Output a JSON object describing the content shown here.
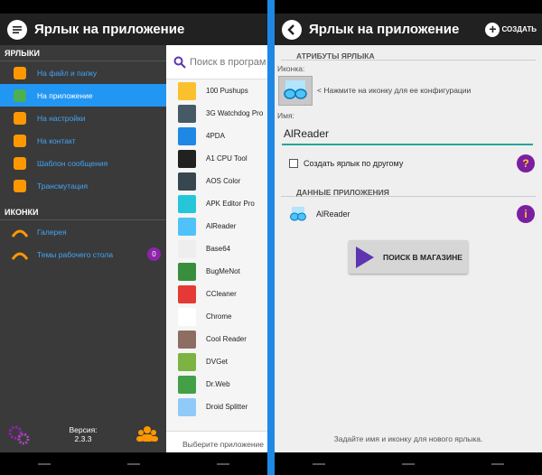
{
  "left": {
    "title": "Ярлык на приложение",
    "shortcuts_section": "ЯРЛЫКИ",
    "shortcuts": [
      {
        "label": "На файл и папку",
        "icon": "file-folder-icon",
        "color": "#ff9800"
      },
      {
        "label": "На приложение",
        "icon": "app-icon",
        "color": "#4caf50",
        "active": true
      },
      {
        "label": "На настройки",
        "icon": "settings-icon",
        "color": "#ff9800"
      },
      {
        "label": "На контакт",
        "icon": "contact-icon",
        "color": "#ff9800"
      },
      {
        "label": "Шаблон сообщения",
        "icon": "message-icon",
        "color": "#ff9800"
      },
      {
        "label": "Трансмутация",
        "icon": "transmutation-icon",
        "color": "#ff9800"
      }
    ],
    "icons_section": "ИКОНКИ",
    "icon_items": [
      {
        "label": "Галерея",
        "icon": "gallery-icon"
      },
      {
        "label": "Темы рабочего стола",
        "icon": "themes-icon",
        "badge": "0"
      }
    ],
    "version_label": "Версия:",
    "version_value": "2.3.3",
    "search_placeholder": "Поиск в програм",
    "apps": [
      {
        "name": "100 Pushups",
        "color": "#fbc02d"
      },
      {
        "name": "3G Watchdog Pro",
        "color": "#455a64"
      },
      {
        "name": "4PDA",
        "color": "#1e88e5"
      },
      {
        "name": "A1 CPU Tool",
        "color": "#212121"
      },
      {
        "name": "AOS Color",
        "color": "#37474f"
      },
      {
        "name": "APK Editor Pro",
        "color": "#26c6da"
      },
      {
        "name": "AlReader",
        "color": "#4fc3f7"
      },
      {
        "name": "Base64",
        "color": "#eeeeee"
      },
      {
        "name": "BugMeNot",
        "color": "#388e3c"
      },
      {
        "name": "CCleaner",
        "color": "#e53935"
      },
      {
        "name": "Chrome",
        "color": "#ffffff"
      },
      {
        "name": "Cool Reader",
        "color": "#8d6e63"
      },
      {
        "name": "DVGet",
        "color": "#7cb342"
      },
      {
        "name": "Dr.Web",
        "color": "#43a047"
      },
      {
        "name": "Droid Splitter",
        "color": "#90caf9"
      }
    ],
    "list_footer": "Выберите приложение"
  },
  "right": {
    "title": "Ярлык на приложение",
    "create_label": "СОЗДАТЬ",
    "attrs_section": "АТРИБУТЫ ЯРЛЫКА",
    "icon_label": "Иконка:",
    "icon_hint": "< Нажмите на иконку для ее конфигурации",
    "name_label": "Имя:",
    "name_value": "AlReader",
    "other_shortcut_label": "Создать ярлык по другому",
    "app_data_section": "ДАННЫЕ ПРИЛОЖЕНИЯ",
    "app_name": "AlReader",
    "store_button": "ПОИСК В МАГАЗИНЕ",
    "bottom_hint": "Задайте имя и иконку для нового ярлыка."
  },
  "colors": {
    "accent": "#2196f3",
    "toolbar": "#212121",
    "drawer": "#3a3a3a",
    "help": "#7b1fa2"
  }
}
